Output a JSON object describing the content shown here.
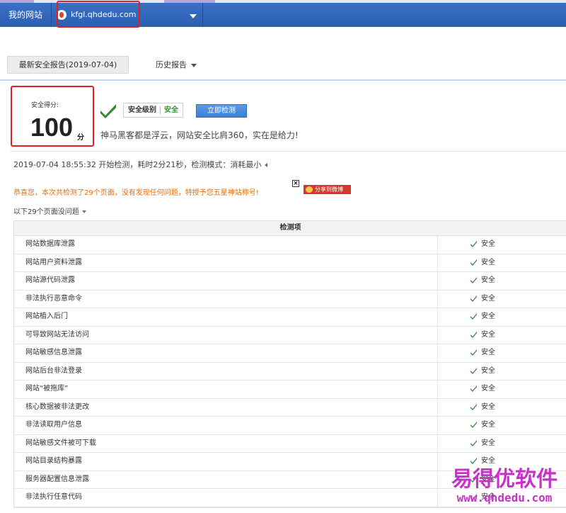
{
  "colors": {
    "nav": "#2b5fb3",
    "accent_red": "#e02020",
    "safe_green": "#2a9a2a",
    "notice_orange": "#e07010",
    "watermark": "#c832c8"
  },
  "nav": {
    "home_label": "我的网站",
    "site_domain": "kfgl.qhdedu.com"
  },
  "tabs": {
    "latest_report": "最新安全报告(2019-07-04)",
    "history_report": "历史报告"
  },
  "score": {
    "label": "安全得分:",
    "value": "100",
    "unit": "分"
  },
  "level": {
    "label": "安全级别",
    "value": "安全"
  },
  "scan_button": "立即检测",
  "slogan": "神马黑客都是浮云，网站安全比肩360，实在是给力!",
  "scan_info": "2019-07-04 18:55:32 开始检测，耗时2分21秒，检测模式：消耗最小",
  "congrats": "恭喜您，本次共检测了29个页面，没有发现任何问题，特授予您五星神站称号!",
  "share_label": "分享到微博",
  "summary": "以下29个页面没问题",
  "table": {
    "header": "检测项",
    "rows": [
      {
        "name": "网站数据库泄露",
        "status": "安全"
      },
      {
        "name": "网站用户资料泄露",
        "status": "安全"
      },
      {
        "name": "网站源代码泄露",
        "status": "安全"
      },
      {
        "name": "非法执行恶意命令",
        "status": "安全"
      },
      {
        "name": "网站植入后门",
        "status": "安全"
      },
      {
        "name": "可导致网站无法访问",
        "status": "安全"
      },
      {
        "name": "网站敏感信息泄露",
        "status": "安全"
      },
      {
        "name": "网站后台非法登录",
        "status": "安全"
      },
      {
        "name": "网站“被拖库”",
        "status": "安全"
      },
      {
        "name": "核心数据被非法更改",
        "status": "安全"
      },
      {
        "name": "非法读取用户信息",
        "status": "安全"
      },
      {
        "name": "网站敏感文件被可下载",
        "status": "安全"
      },
      {
        "name": "网站目录结构暴露",
        "status": "安全"
      },
      {
        "name": "服务器配置信息泄露",
        "status": "安全"
      },
      {
        "name": "非法执行任意代码",
        "status": "安全"
      }
    ]
  },
  "watermark": {
    "name": "易得优软件",
    "url": "www.qhdedu.com"
  }
}
